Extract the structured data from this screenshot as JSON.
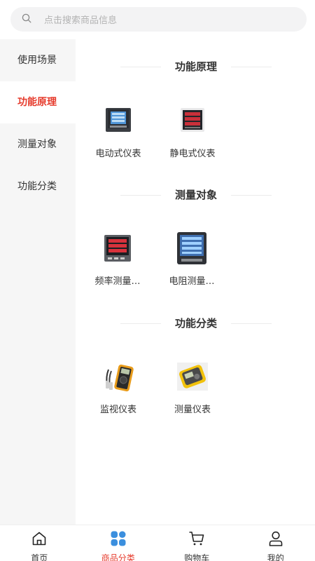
{
  "search": {
    "placeholder": "点击搜索商品信息",
    "icon": "search-icon"
  },
  "sidebar": {
    "items": [
      {
        "label": "使用场景",
        "active": false
      },
      {
        "label": "功能原理",
        "active": true
      },
      {
        "label": "测量对象",
        "active": false
      },
      {
        "label": "功能分类",
        "active": false
      }
    ]
  },
  "sections": [
    {
      "title": "功能原理",
      "products": [
        {
          "name": "电动式仪表",
          "icon": "panel-meter-blue"
        },
        {
          "name": "静电式仪表",
          "icon": "panel-meter-red"
        }
      ]
    },
    {
      "title": "测量对象",
      "products": [
        {
          "name": "频率测量…",
          "icon": "panel-meter-red-digits"
        },
        {
          "name": "电阻测量…",
          "icon": "panel-meter-blue-screen"
        }
      ]
    },
    {
      "title": "功能分类",
      "products": [
        {
          "name": "监视仪表",
          "icon": "handheld-multimeter"
        },
        {
          "name": "测量仪表",
          "icon": "insulation-tester"
        }
      ]
    }
  ],
  "tabbar": {
    "items": [
      {
        "label": "首页",
        "icon": "home-icon",
        "active": false
      },
      {
        "label": "商品分类",
        "icon": "category-icon",
        "active": true
      },
      {
        "label": "购物车",
        "icon": "cart-icon",
        "active": false
      },
      {
        "label": "我的",
        "icon": "user-icon",
        "active": false
      }
    ]
  },
  "colors": {
    "accent": "#e63b2c",
    "category_icon": "#3b8fde"
  }
}
